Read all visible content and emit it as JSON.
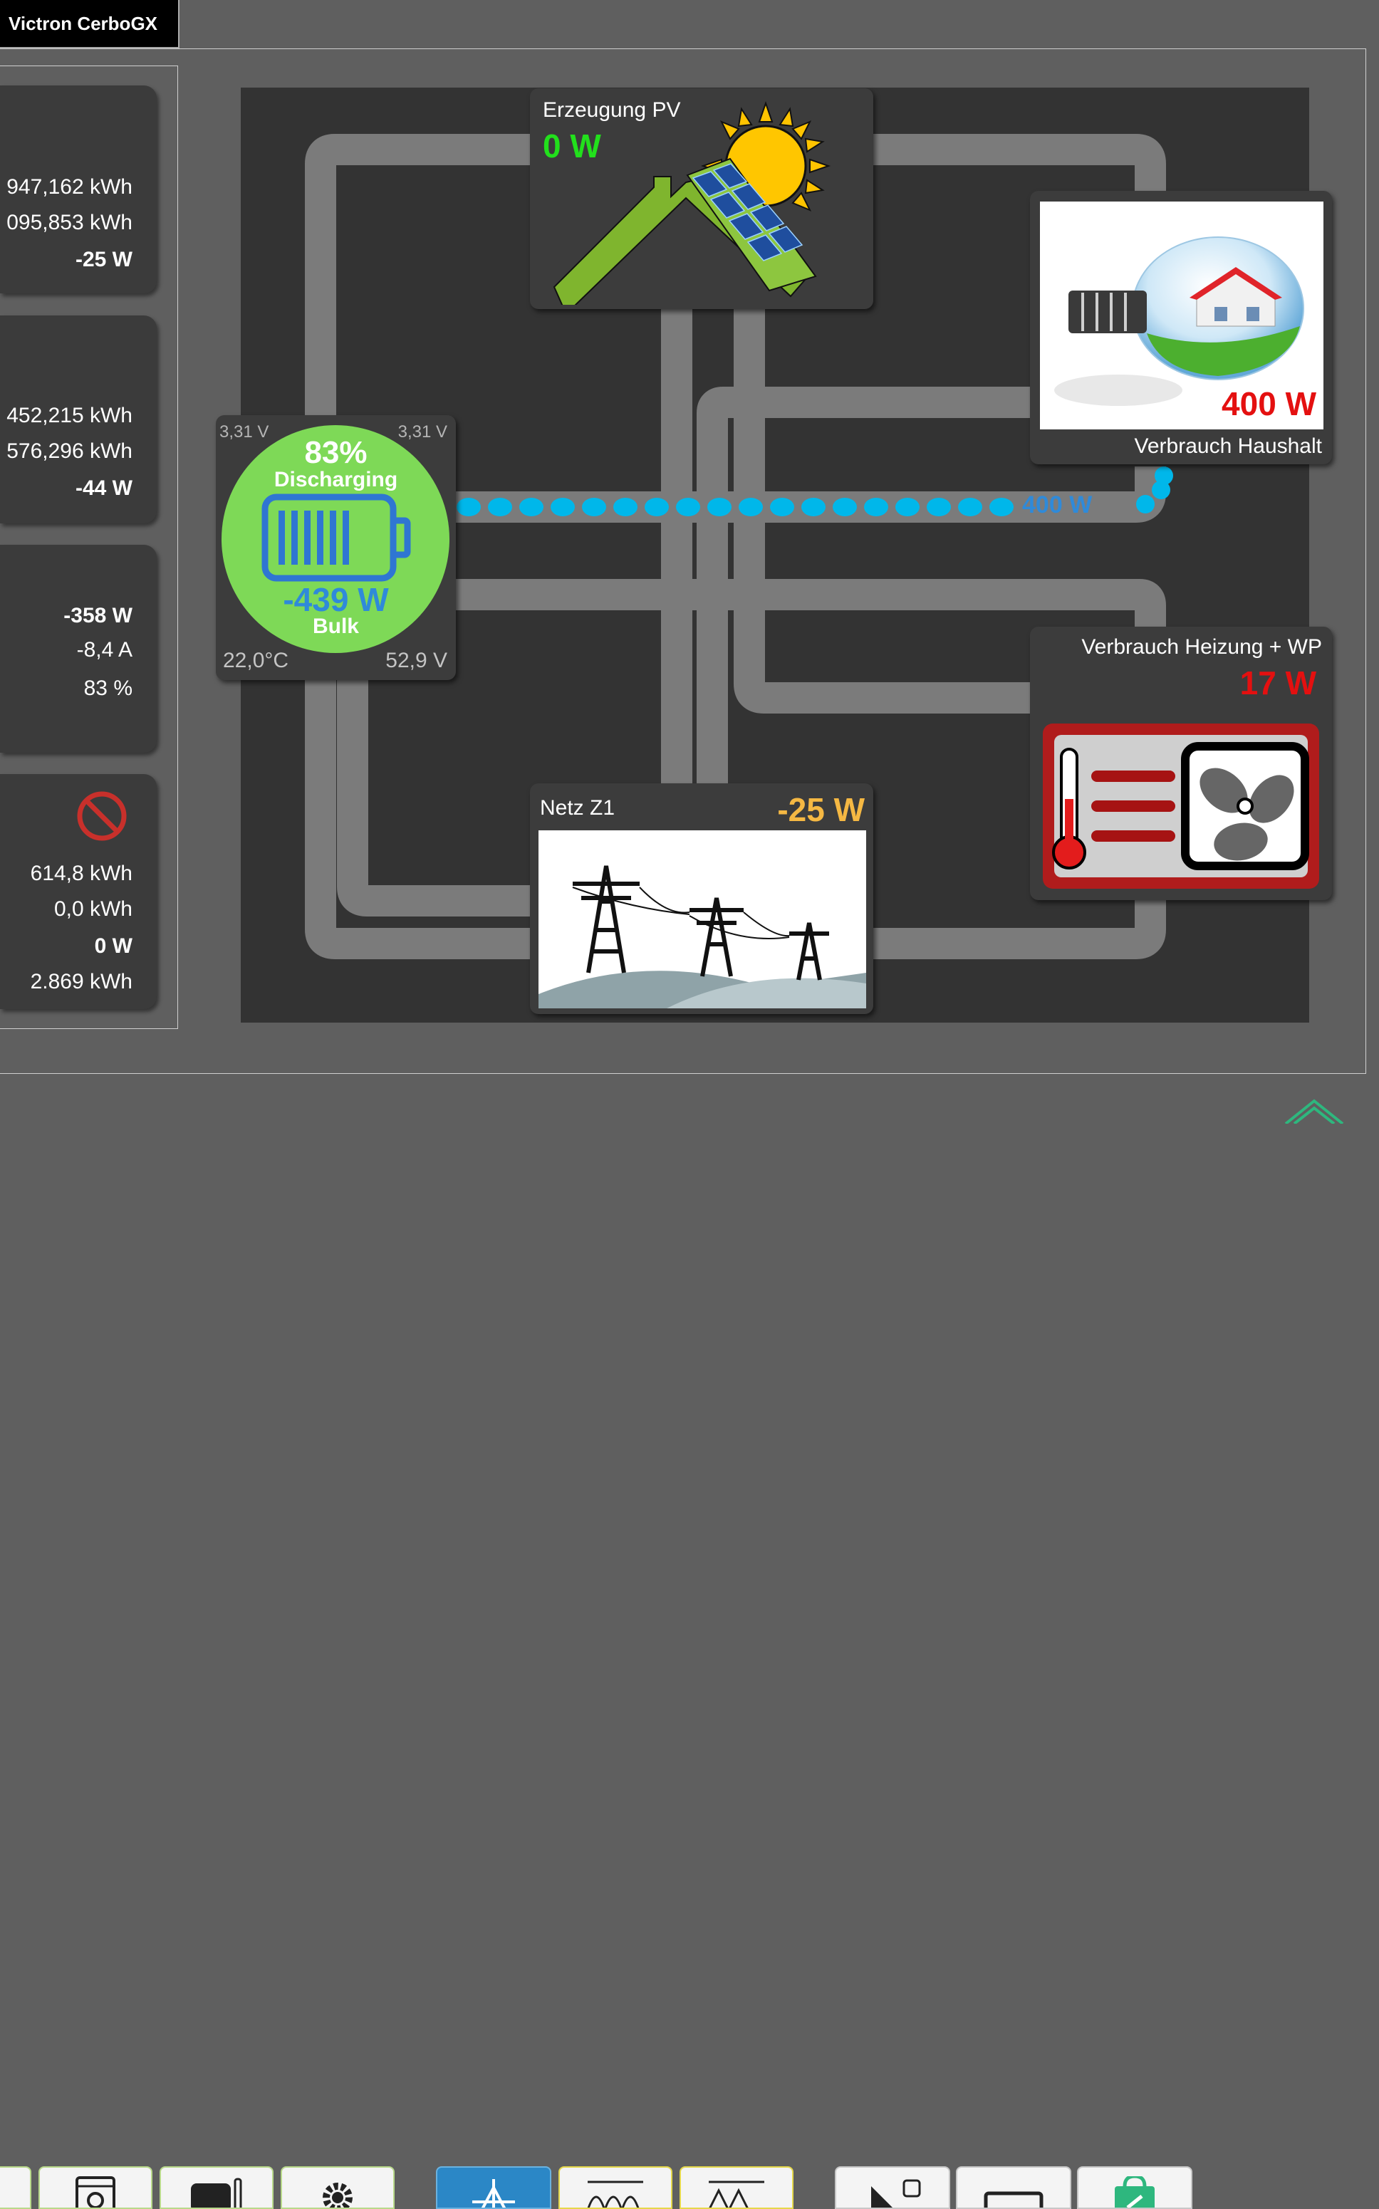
{
  "window": {
    "title": "Victron CerboGX"
  },
  "sidebar": {
    "cards": [
      {
        "rows": [
          "947,162 kWh",
          "095,853 kWh",
          "-25 W"
        ]
      },
      {
        "rows": [
          "452,215 kWh",
          "576,296 kWh",
          "-44 W"
        ]
      },
      {
        "rows": [
          "-358 W",
          "-8,4 A",
          "83 %"
        ]
      },
      {
        "icon": "no-entry-icon",
        "rows": [
          "614,8 kWh",
          "0,0 kWh",
          "0 W",
          "2.869 kWh"
        ]
      }
    ]
  },
  "pv": {
    "title": "Erzeugung PV",
    "power": "0 W",
    "icon": "solar-roof-icon",
    "color": "#22e01c"
  },
  "household": {
    "title": "Verbrauch Haushalt",
    "power": "400 W",
    "icon": "lightbulb-house-icon",
    "color": "#e41010"
  },
  "battery": {
    "voltage_left": "3,31 V",
    "voltage_right": "3,31 V",
    "soc": "83%",
    "state": "Discharging",
    "power": "-439 W",
    "charge_phase": "Bulk",
    "temperature": "22,0°C",
    "voltage": "52,9 V",
    "icon": "battery-icon",
    "color": "#7ed957"
  },
  "flow": {
    "label": "400 W",
    "color": "#00b7ea"
  },
  "heating": {
    "title": "Verbrauch Heizung + WP",
    "power": "17 W",
    "icon": "heater-fan-icon",
    "color": "#e41010"
  },
  "grid": {
    "title": "Netz Z1",
    "power": "-25 W",
    "icon": "power-pylons-icon",
    "color": "#f5b843"
  },
  "nav": {
    "buttons": [
      {
        "icon": "partial-icon"
      },
      {
        "icon": "washing-machine-icon"
      },
      {
        "icon": "generator-icon"
      },
      {
        "icon": "gear-icon"
      },
      {
        "icon": "flow-icon",
        "active": true
      },
      {
        "icon": "chart-icon"
      },
      {
        "icon": "chart-icon"
      },
      {
        "icon": "play-icon"
      },
      {
        "icon": "monitor-icon"
      },
      {
        "icon": "shop-bag-icon"
      },
      {
        "icon": "victron-logo-icon"
      }
    ]
  }
}
